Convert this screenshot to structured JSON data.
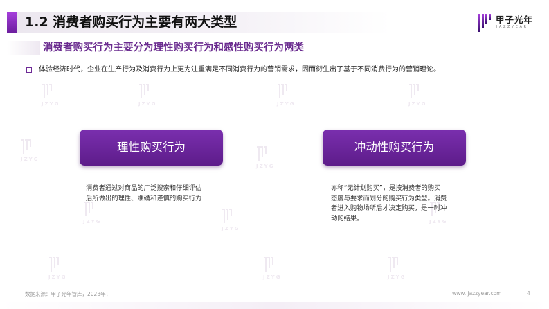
{
  "header": {
    "title": "1.2 消费者购买行为主要有两大类型",
    "subtitle": "消费者购买行为主要分为理性购买行为和感性购买行为两类"
  },
  "logo": {
    "name": "甲子光年",
    "tagline": "JAZZYEAR",
    "icon": "jazzyear-logo-icon"
  },
  "watermark": {
    "text": "JZYG",
    "icon": "jazzyear-watermark-icon"
  },
  "intro": {
    "text": "体验经济时代，企业在生产行为及消费行为上更为注重满足不同消费行为的营销需求，因而衍生出了基于不同消费行为的营销理论。"
  },
  "categories": [
    {
      "label": "理性购买行为",
      "description_lines": [
        "消费者通过对商品的广泛搜索和仔细评估",
        "后所做出的理性、准确和谨慎的购买行为"
      ]
    },
    {
      "label": "冲动性购买行为",
      "description_lines": [
        "亦称“无计划购买”，是按消费者的购买",
        "态度与要求而划分的购买行为类型。消费",
        "者进入购物场所后才决定购买，是一时冲",
        "动的结果。"
      ]
    }
  ],
  "footer": {
    "source": "数据来源：甲子光年智库，2023年；",
    "website": "www. jazzyear.com",
    "page": "4"
  },
  "colors": {
    "accent": "#6a2b8f",
    "button": "#6d25a0",
    "title_bar": "#8a2fc4"
  }
}
